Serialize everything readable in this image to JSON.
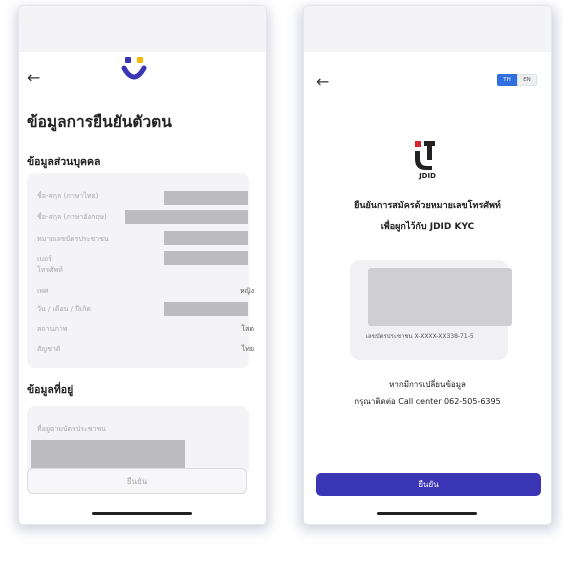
{
  "left_screen": {
    "title": "ข้อมูลการยืนยันตัวตน",
    "personal_section": {
      "heading": "ข้อมูลส่วนบุคคล",
      "rows": [
        {
          "label": "ชื่อ-สกุล (ภาษาไทย)",
          "value": ""
        },
        {
          "label": "ชื่อ-สกุล (ภาษาอังกฤษ)",
          "value": ""
        },
        {
          "label": "หมายเลขบัตรประชาชน",
          "value": ""
        },
        {
          "label": "เบอร์",
          "label2": "โทรศัพท์",
          "value": ""
        },
        {
          "label": "เพศ",
          "value": "หญิง"
        },
        {
          "label": "วัน / เดือน / ปีเกิด",
          "value": ""
        },
        {
          "label": "สถานภาพ",
          "value": "โสด"
        },
        {
          "label": "สัญชาติ",
          "value": "ไทย"
        }
      ]
    },
    "address_section": {
      "heading": "ข้อมูลที่อยู่",
      "label": "ที่อยู่ตามบัตรประชาชน"
    },
    "confirm_label": "ยืนยัน"
  },
  "right_screen": {
    "lang_th": "TH",
    "lang_en": "EN",
    "brand": "JDID",
    "heading_line1": "ยืนยันการสมัครด้วยหมายเลขโทรศัพท์",
    "heading_line2": "เพื่อผูกไว้กับ JDID KYC",
    "id_card_text": "เลขบัตรประชาชน X-XXXX-XX338-71-5",
    "info_line1": "หากมีการเปลี่ยนข้อมูล",
    "info_line2": "กรุณาติดต่อ Call center 062-505-6395",
    "confirm_label": "ยืนยัน"
  },
  "colors": {
    "primary": "#3a35b4",
    "lang_active": "#2f6fe0",
    "logo_yellow": "#f5b800",
    "logo_purple": "#3a35b4",
    "jdid_red": "#d9242a",
    "card_bg": "#f4f4f6",
    "redaction": "#bcbcc0"
  },
  "icons": [
    "back-arrow-icon",
    "smile-logo-icon",
    "jdid-logo-icon"
  ]
}
